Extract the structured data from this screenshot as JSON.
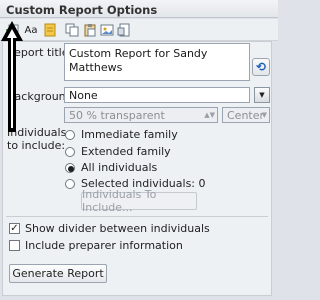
{
  "panel": {
    "title": "Custom Report Options"
  },
  "toolbar": {
    "icons": [
      "insert-field-icon",
      "font-icon",
      "note-icon",
      "copy-icon",
      "paste-icon",
      "image-icon",
      "page-icon"
    ],
    "font_glyph": "Aa"
  },
  "report_title": {
    "label": "Report title:",
    "value": "Custom Report for Sandy Matthews"
  },
  "background": {
    "label": "Background:",
    "selected": "None",
    "transparency": "50  % transparent",
    "alignment": "Center"
  },
  "individuals": {
    "label_line1": "Individuals",
    "label_line2": "to include:",
    "options": [
      "Immediate family",
      "Extended family",
      "All individuals",
      "Selected individuals: 0"
    ],
    "selected_index": 2,
    "include_button": "Individuals To Include..."
  },
  "checkboxes": {
    "divider": {
      "label": "Show divider between individuals",
      "checked": true
    },
    "preparer": {
      "label": "Include preparer information",
      "checked": false
    }
  },
  "generate_button": "Generate Report",
  "colors": {
    "accent": "#1d5fb8",
    "arrow": "#000000",
    "panel_bg": "#eef1f4"
  }
}
